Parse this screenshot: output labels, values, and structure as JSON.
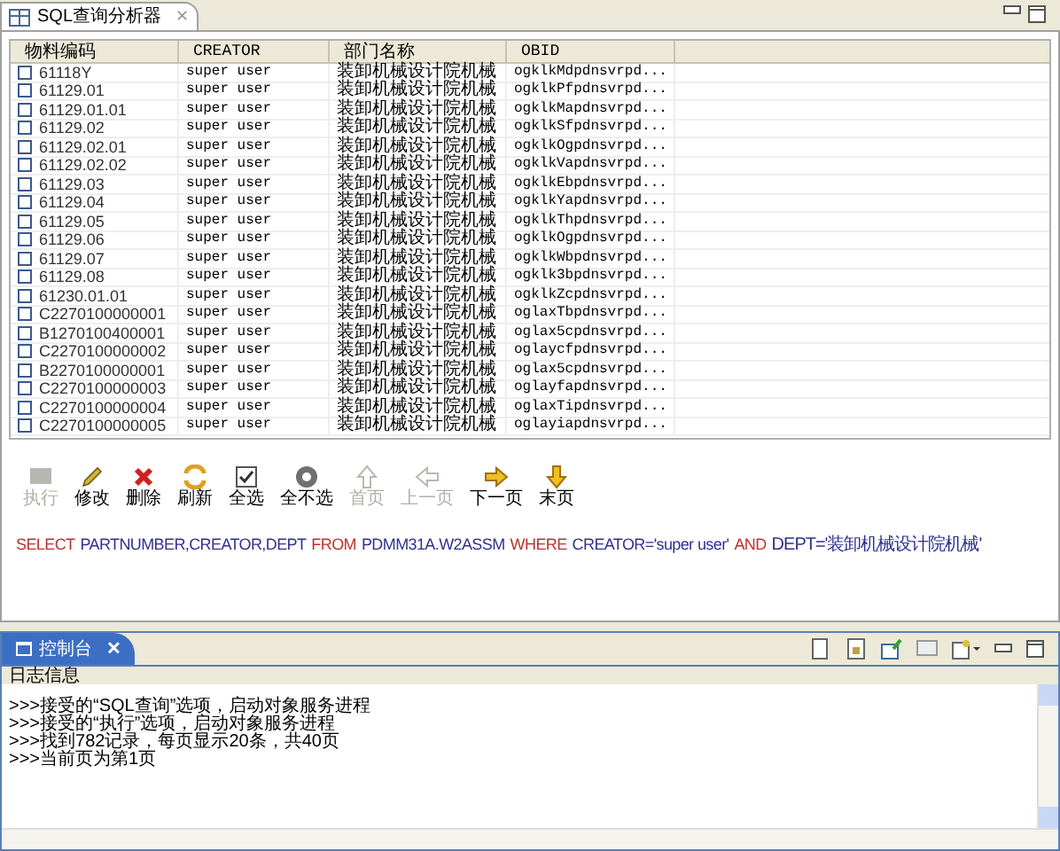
{
  "editor_tab": {
    "title": "SQL查询分析器",
    "close": "✕"
  },
  "table": {
    "columns": [
      "物料编码",
      "CREATOR",
      "部门名称",
      "OBID"
    ],
    "rows": [
      {
        "checked": false,
        "cells": [
          "61118Y",
          "super user",
          "装卸机械设计院机械",
          "ogklkMdpdnsvrpd..."
        ]
      },
      {
        "checked": false,
        "cells": [
          "61129.01",
          "super user",
          "装卸机械设计院机械",
          "ogklkPfpdnsvrpd..."
        ]
      },
      {
        "checked": false,
        "cells": [
          "61129.01.01",
          "super user",
          "装卸机械设计院机械",
          "ogklkMapdnsvrpd..."
        ]
      },
      {
        "checked": false,
        "cells": [
          "61129.02",
          "super user",
          "装卸机械设计院机械",
          "ogklkSfpdnsvrpd..."
        ]
      },
      {
        "checked": false,
        "cells": [
          "61129.02.01",
          "super user",
          "装卸机械设计院机械",
          "ogklkOgpdnsvrpd..."
        ]
      },
      {
        "checked": false,
        "cells": [
          "61129.02.02",
          "super user",
          "装卸机械设计院机械",
          "ogklkVapdnsvrpd..."
        ]
      },
      {
        "checked": false,
        "cells": [
          "61129.03",
          "super user",
          "装卸机械设计院机械",
          "ogklkEbpdnsvrpd..."
        ]
      },
      {
        "checked": false,
        "cells": [
          "61129.04",
          "super user",
          "装卸机械设计院机械",
          "ogklkYapdnsvrpd..."
        ]
      },
      {
        "checked": false,
        "cells": [
          "61129.05",
          "super user",
          "装卸机械设计院机械",
          "ogklkThpdnsvrpd..."
        ]
      },
      {
        "checked": false,
        "cells": [
          "61129.06",
          "super user",
          "装卸机械设计院机械",
          "ogklkOgpdnsvrpd..."
        ]
      },
      {
        "checked": false,
        "cells": [
          "61129.07",
          "super user",
          "装卸机械设计院机械",
          "ogklkWbpdnsvrpd..."
        ]
      },
      {
        "checked": false,
        "cells": [
          "61129.08",
          "super user",
          "装卸机械设计院机械",
          "ogklk3bpdnsvrpd..."
        ]
      },
      {
        "checked": false,
        "cells": [
          "61230.01.01",
          "super user",
          "装卸机械设计院机械",
          "ogklkZcpdnsvrpd..."
        ]
      },
      {
        "checked": false,
        "cells": [
          "C2270100000001",
          "super user",
          "装卸机械设计院机械",
          "oglaxTbpdnsvrpd..."
        ]
      },
      {
        "checked": false,
        "cells": [
          "B1270100400001",
          "super user",
          "装卸机械设计院机械",
          "oglax5cpdnsvrpd..."
        ]
      },
      {
        "checked": false,
        "cells": [
          "C2270100000002",
          "super user",
          "装卸机械设计院机械",
          "oglaycfpdnsvrpd..."
        ]
      },
      {
        "checked": false,
        "cells": [
          "B2270100000001",
          "super user",
          "装卸机械设计院机械",
          "oglax5cpdnsvrpd..."
        ]
      },
      {
        "checked": false,
        "cells": [
          "C2270100000003",
          "super user",
          "装卸机械设计院机械",
          "oglayfapdnsvrpd..."
        ]
      },
      {
        "checked": false,
        "cells": [
          "C2270100000004",
          "super user",
          "装卸机械设计院机械",
          "oglaxTipdnsvrpd..."
        ]
      },
      {
        "checked": false,
        "cells": [
          "C2270100000005",
          "super user",
          "装卸机械设计院机械",
          "oglayiapdnsvrpd..."
        ]
      }
    ]
  },
  "toolbar": [
    {
      "kind": "run",
      "label": "执行",
      "disabled": true
    },
    {
      "kind": "edit",
      "label": "修改",
      "disabled": false
    },
    {
      "kind": "delete",
      "label": "删除",
      "disabled": false
    },
    {
      "kind": "refresh",
      "label": "刷新",
      "disabled": false
    },
    {
      "kind": "selectall",
      "label": "全选",
      "disabled": false
    },
    {
      "kind": "selectnone",
      "label": "全不选",
      "disabled": false
    },
    {
      "kind": "first",
      "label": "首页",
      "disabled": true
    },
    {
      "kind": "prev",
      "label": "上一页",
      "disabled": true
    },
    {
      "kind": "next",
      "label": "下一页",
      "disabled": false
    },
    {
      "kind": "last",
      "label": "末页",
      "disabled": false
    }
  ],
  "sql": [
    {
      "kind": "keyword",
      "text": "SELECT"
    },
    {
      "kind": "identifier",
      "text": "PARTNUMBER,CREATOR,DEPT"
    },
    {
      "kind": "keyword",
      "text": "FROM"
    },
    {
      "kind": "identifier",
      "text": "PDMM31A.W2ASSM"
    },
    {
      "kind": "keyword",
      "text": "WHERE"
    },
    {
      "kind": "identifier",
      "text": "CREATOR='super user'"
    },
    {
      "kind": "keyword",
      "text": "AND"
    },
    {
      "kind": "identifier",
      "text": "DEPT='装卸机械设计院机械'"
    }
  ],
  "console": {
    "tab": {
      "title": "控制台",
      "close": "✕"
    },
    "header": "日志信息",
    "lines": [
      ">>>接受的“SQL查询”选项，启动对象服务进程",
      ">>>接受的“执行”选项，启动对象服务进程",
      ">>>找到782记录，每页显示20条，共40页",
      ">>>当前页为第1页"
    ]
  }
}
